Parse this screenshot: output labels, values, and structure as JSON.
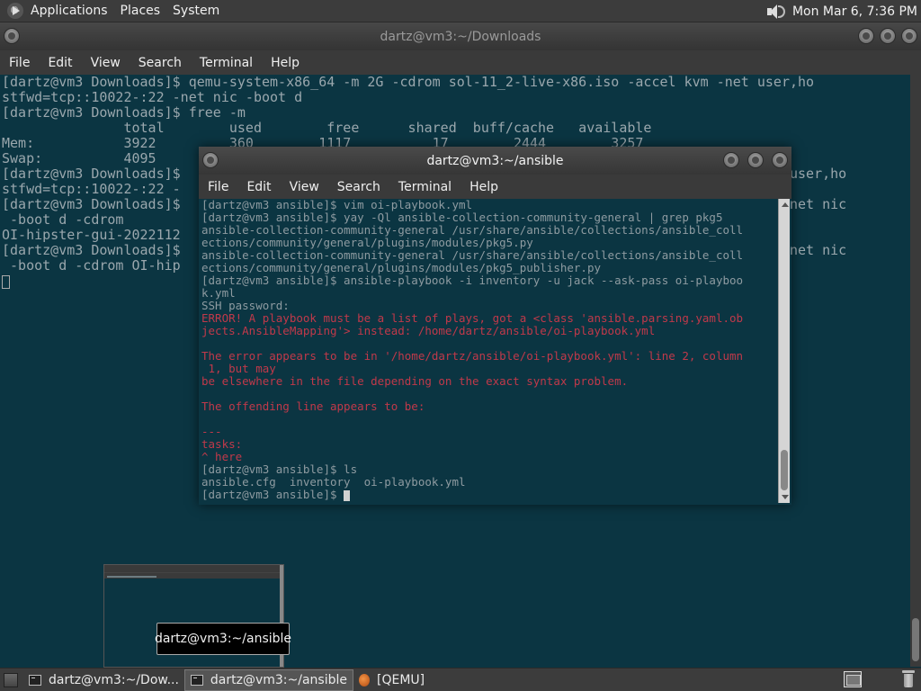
{
  "top_panel": {
    "menus": [
      "Applications",
      "Places",
      "System"
    ],
    "clock": "Mon Mar  6,  7:36 PM"
  },
  "win_downloads": {
    "title": "dartz@vm3:~/Downloads",
    "menu": [
      "File",
      "Edit",
      "View",
      "Search",
      "Terminal",
      "Help"
    ],
    "lines": [
      "[dartz@vm3 Downloads]$ qemu-system-x86_64 -m 2G -cdrom sol-11_2-live-x86.iso -accel kvm -net user,ho",
      "stfwd=tcp::10022-:22 -net nic -boot d",
      "[dartz@vm3 Downloads]$ free -m",
      "               total        used        free      shared  buff/cache   available",
      "Mem:           3922         360        1117          17        2444        3257",
      "Swap:          4095",
      "[dartz@vm3 Downloads]$                                                                      -net user,ho",
      "stfwd=tcp::10022-:22 -",
      "[dartz@vm3 Downloads]$                                                                      :22 -net nic",
      " -boot d -cdrom",
      "OI-hipster-gui-2022112",
      "[dartz@vm3 Downloads]$                                                                      :22 -net nic",
      " -boot d -cdrom OI-hip"
    ]
  },
  "win_ansible": {
    "title": "dartz@vm3:~/ansible",
    "menu": [
      "File",
      "Edit",
      "View",
      "Search",
      "Terminal",
      "Help"
    ],
    "lines": [
      {
        "text": "[dartz@vm3 ansible]$ vim oi-playbook.yml",
        "style": "normal"
      },
      {
        "text": "[dartz@vm3 ansible]$ yay -Ql ansible-collection-community-general | grep pkg5",
        "style": "normal"
      },
      {
        "text": "ansible-collection-community-general /usr/share/ansible/collections/ansible_coll",
        "style": "normal"
      },
      {
        "text": "ections/community/general/plugins/modules/pkg5.py",
        "style": "normal"
      },
      {
        "text": "ansible-collection-community-general /usr/share/ansible/collections/ansible_coll",
        "style": "normal"
      },
      {
        "text": "ections/community/general/plugins/modules/pkg5_publisher.py",
        "style": "normal"
      },
      {
        "text": "[dartz@vm3 ansible]$ ansible-playbook -i inventory -u jack --ask-pass oi-playboo",
        "style": "normal"
      },
      {
        "text": "k.yml",
        "style": "normal"
      },
      {
        "text": "SSH password:",
        "style": "normal"
      },
      {
        "text": "ERROR! A playbook must be a list of plays, got a <class 'ansible.parsing.yaml.ob",
        "style": "err"
      },
      {
        "text": "jects.AnsibleMapping'> instead: /home/dartz/ansible/oi-playbook.yml",
        "style": "err"
      },
      {
        "text": "",
        "style": "err"
      },
      {
        "text": "The error appears to be in '/home/dartz/ansible/oi-playbook.yml': line 2, column",
        "style": "err"
      },
      {
        "text": " 1, but may",
        "style": "err"
      },
      {
        "text": "be elsewhere in the file depending on the exact syntax problem.",
        "style": "err"
      },
      {
        "text": "",
        "style": "err"
      },
      {
        "text": "The offending line appears to be:",
        "style": "err"
      },
      {
        "text": "",
        "style": "err"
      },
      {
        "text": "---",
        "style": "err"
      },
      {
        "text": "tasks:",
        "style": "err"
      },
      {
        "text": "^ here",
        "style": "err"
      },
      {
        "text": "[dartz@vm3 ansible]$ ls",
        "style": "normal"
      },
      {
        "text": "ansible.cfg  inventory  oi-playbook.yml",
        "style": "normal"
      }
    ],
    "prompt": "[dartz@vm3 ansible]$ "
  },
  "tooltip": "dartz@vm3:~/ansible",
  "taskbar": {
    "tasks": [
      "dartz@vm3:~/Dow...",
      "dartz@vm3:~/ansible",
      "[QEMU]"
    ]
  }
}
